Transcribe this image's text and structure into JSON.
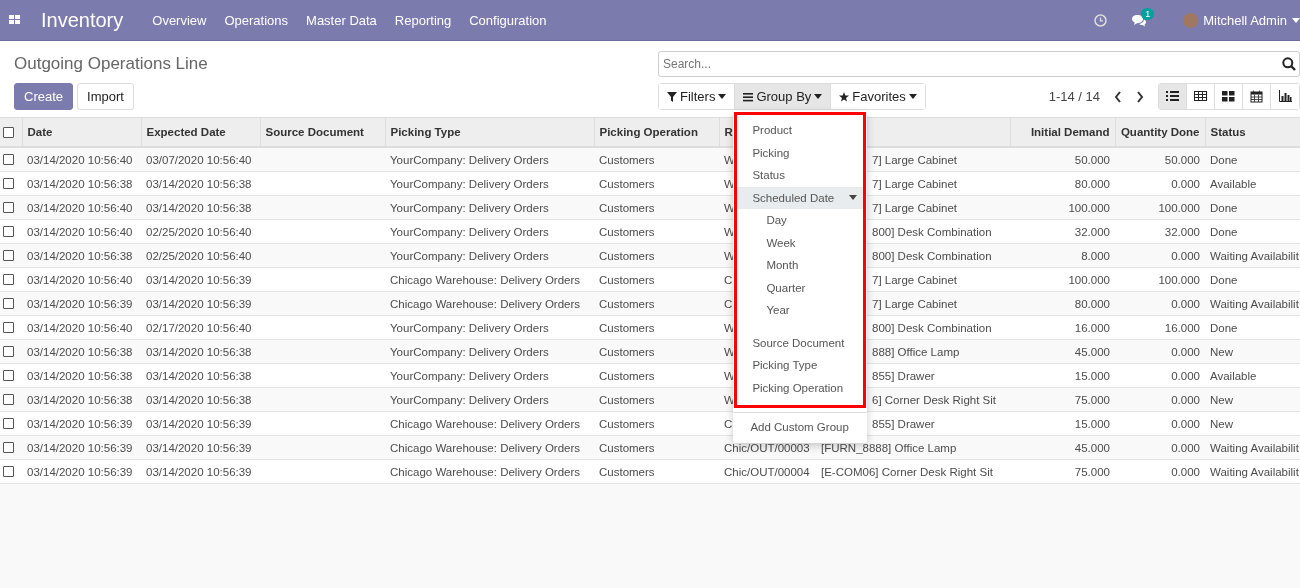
{
  "navbar": {
    "app_title": "Inventory",
    "menu": [
      "Overview",
      "Operations",
      "Master Data",
      "Reporting",
      "Configuration"
    ],
    "message_count": "1",
    "user": "Mitchell Admin"
  },
  "control_panel": {
    "title": "Outgoing Operations Line",
    "buttons": [
      {
        "label": "Create",
        "kind": "primary"
      },
      {
        "label": "Import",
        "kind": "secondary"
      }
    ],
    "search": {
      "placeholder": "Search..."
    },
    "search_buttons": [
      {
        "label": "Filters",
        "kind": "filter",
        "selected": false
      },
      {
        "label": "Group By",
        "kind": "group",
        "selected": true
      },
      {
        "label": "Favorites",
        "kind": "star",
        "selected": false
      }
    ],
    "pager": "1-14 / 14",
    "views": [
      {
        "kind": "list",
        "selected": true
      },
      {
        "kind": "grid",
        "selected": false
      },
      {
        "kind": "kanban",
        "selected": false
      },
      {
        "kind": "calendar",
        "selected": false
      },
      {
        "kind": "graph",
        "selected": false
      }
    ]
  },
  "group_by_menu": {
    "items": [
      {
        "label": "Product"
      },
      {
        "label": "Picking"
      },
      {
        "label": "Status"
      },
      {
        "label": "Scheduled Date",
        "expanded": true,
        "children": [
          {
            "label": "Day"
          },
          {
            "label": "Week"
          },
          {
            "label": "Month"
          },
          {
            "label": "Quarter"
          },
          {
            "label": "Year"
          }
        ]
      },
      {
        "label": "Source Document"
      },
      {
        "label": "Picking Type"
      },
      {
        "label": "Picking Operation"
      }
    ],
    "custom": "Add Custom Group"
  },
  "table": {
    "all_checked": false,
    "columns": [
      "Date",
      "Expected Date",
      "Source Document",
      "Picking Type",
      "Picking Operation",
      "R",
      "",
      "Initial Demand",
      "Quantity Done",
      "Status"
    ],
    "rows": [
      {
        "checked": false,
        "cells": [
          "03/14/2020 10:56:40",
          "03/07/2020 10:56:40",
          "",
          "YourCompany: Delivery Orders",
          "Customers",
          "W",
          "7] Large Cabinet",
          "50.000",
          "50.000",
          "Done"
        ]
      },
      {
        "checked": false,
        "cells": [
          "03/14/2020 10:56:38",
          "03/14/2020 10:56:38",
          "",
          "YourCompany: Delivery Orders",
          "Customers",
          "W",
          "7] Large Cabinet",
          "80.000",
          "0.000",
          "Available"
        ]
      },
      {
        "checked": false,
        "cells": [
          "03/14/2020 10:56:40",
          "03/14/2020 10:56:38",
          "",
          "YourCompany: Delivery Orders",
          "Customers",
          "W",
          "7] Large Cabinet",
          "100.000",
          "100.000",
          "Done"
        ]
      },
      {
        "checked": false,
        "cells": [
          "03/14/2020 10:56:40",
          "02/25/2020 10:56:40",
          "",
          "YourCompany: Delivery Orders",
          "Customers",
          "W",
          "800] Desk Combination",
          "32.000",
          "32.000",
          "Done"
        ]
      },
      {
        "checked": false,
        "cells": [
          "03/14/2020 10:56:38",
          "02/25/2020 10:56:40",
          "",
          "YourCompany: Delivery Orders",
          "Customers",
          "W",
          "800] Desk Combination",
          "8.000",
          "0.000",
          "Waiting Availabilit"
        ]
      },
      {
        "checked": false,
        "cells": [
          "03/14/2020 10:56:40",
          "03/14/2020 10:56:39",
          "",
          "Chicago Warehouse: Delivery Orders",
          "Customers",
          "C",
          "7] Large Cabinet",
          "100.000",
          "100.000",
          "Done"
        ]
      },
      {
        "checked": false,
        "cells": [
          "03/14/2020 10:56:39",
          "03/14/2020 10:56:39",
          "",
          "Chicago Warehouse: Delivery Orders",
          "Customers",
          "C",
          "7] Large Cabinet",
          "80.000",
          "0.000",
          "Waiting Availabilit"
        ]
      },
      {
        "checked": false,
        "cells": [
          "03/14/2020 10:56:40",
          "02/17/2020 10:56:40",
          "",
          "YourCompany: Delivery Orders",
          "Customers",
          "W",
          "800] Desk Combination",
          "16.000",
          "16.000",
          "Done"
        ]
      },
      {
        "checked": false,
        "cells": [
          "03/14/2020 10:56:38",
          "03/14/2020 10:56:38",
          "",
          "YourCompany: Delivery Orders",
          "Customers",
          "W",
          "888] Office Lamp",
          "45.000",
          "0.000",
          "New"
        ]
      },
      {
        "checked": false,
        "cells": [
          "03/14/2020 10:56:38",
          "03/14/2020 10:56:38",
          "",
          "YourCompany: Delivery Orders",
          "Customers",
          "W",
          "855] Drawer",
          "15.000",
          "0.000",
          "Available"
        ]
      },
      {
        "checked": false,
        "cells": [
          "03/14/2020 10:56:38",
          "03/14/2020 10:56:38",
          "",
          "YourCompany: Delivery Orders",
          "Customers",
          "W",
          "6] Corner Desk Right Sit",
          "75.000",
          "0.000",
          "New"
        ]
      },
      {
        "checked": false,
        "cells": [
          "03/14/2020 10:56:39",
          "03/14/2020 10:56:39",
          "",
          "Chicago Warehouse: Delivery Orders",
          "Customers",
          "C",
          "855] Drawer",
          "15.000",
          "0.000",
          "New"
        ]
      },
      {
        "checked": false,
        "cells": [
          "03/14/2020 10:56:39",
          "03/14/2020 10:56:39",
          "",
          "Chicago Warehouse: Delivery Orders",
          "Customers",
          "Chic/OUT/00003",
          "[FURN_8888] Office Lamp",
          "45.000",
          "0.000",
          "Waiting Availabilit"
        ]
      },
      {
        "checked": false,
        "cells": [
          "03/14/2020 10:56:39",
          "03/14/2020 10:56:39",
          "",
          "Chicago Warehouse: Delivery Orders",
          "Customers",
          "Chic/OUT/00004",
          "[E-COM06] Corner Desk Right Sit",
          "75.000",
          "0.000",
          "Waiting Availabilit"
        ]
      }
    ]
  }
}
